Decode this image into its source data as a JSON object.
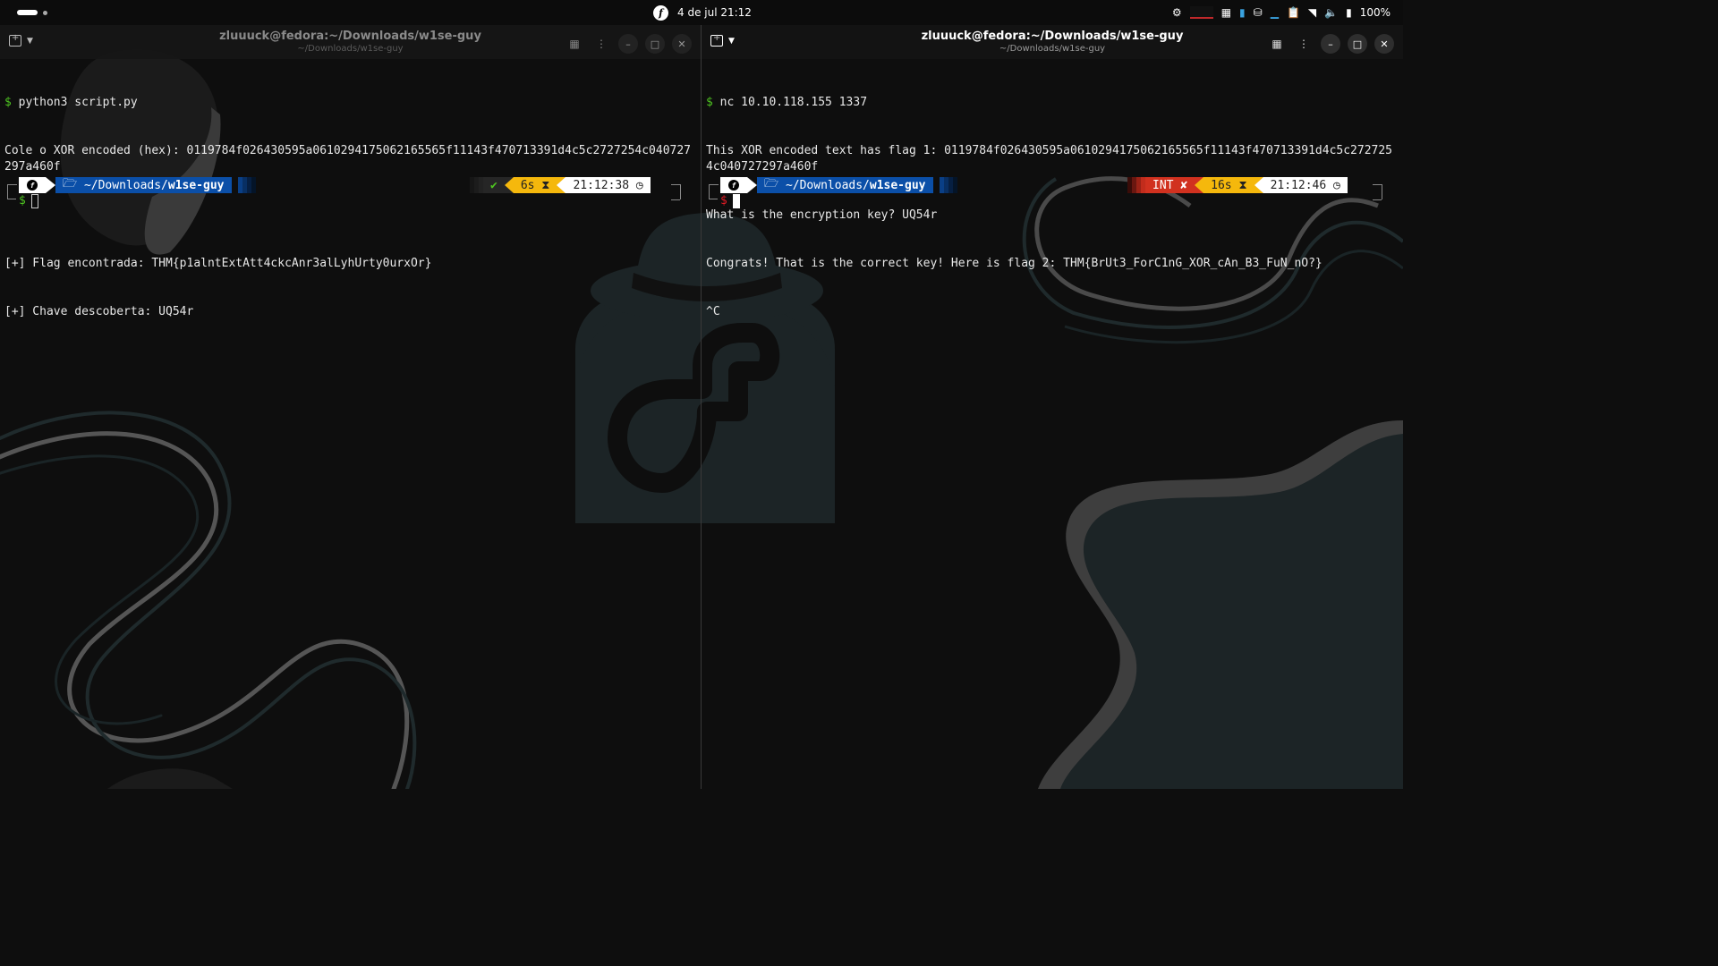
{
  "topbar": {
    "datetime": "4 de jul  21:12",
    "battery": "100%",
    "icons": [
      "activities-pill-icon",
      "fedora-logo-icon",
      "cpu-icon",
      "memory-icon",
      "network-monitor-icon",
      "drive-icon",
      "clipboard-icon",
      "wifi-icon",
      "volume-icon",
      "battery-icon"
    ]
  },
  "left_terminal": {
    "title": "zluuuck@fedora:~/Downloads/w1se-guy",
    "subtitle": "~/Downloads/w1se-guy",
    "lines": [
      {
        "sym": "$",
        "text": " python3 script.py"
      },
      {
        "sym": "",
        "text": "Cole o XOR encoded (hex): 0119784f026430595a0610294175062165565f11143f470713391d4c5c2727254c040727297a460f"
      },
      {
        "sym": "",
        "text": ""
      },
      {
        "sym": "",
        "text": "[+] Flag encontrada: THM{p1alntExtAtt4ckcAnr3alLyhUrty0urxOr}"
      },
      {
        "sym": "",
        "text": "[+] Chave descoberta: UQ54r"
      }
    ],
    "prompt": {
      "dir_prefix": " ~/Downloads/",
      "dir_bold": "w1se-guy",
      "status": "✔",
      "duration": "6s",
      "time": "21:12:38",
      "ps2": "$"
    }
  },
  "right_terminal": {
    "title": "zluuuck@fedora:~/Downloads/w1se-guy",
    "subtitle": "~/Downloads/w1se-guy",
    "lines": [
      {
        "sym": "$",
        "text": " nc 10.10.118.155 1337"
      },
      {
        "sym": "",
        "text": "This XOR encoded text has flag 1: 0119784f026430595a0610294175062165565f11143f470713391d4c5c2727254c040727297a460f"
      },
      {
        "sym": "",
        "text": "What is the encryption key? UQ54r"
      },
      {
        "sym": "",
        "text": "Congrats! That is the correct key! Here is flag 2: THM{BrUt3_ForC1nG_XOR_cAn_B3_FuN_nO?}"
      },
      {
        "sym": "",
        "text": "^C"
      }
    ],
    "prompt": {
      "dir_prefix": " ~/Downloads/",
      "dir_bold": "w1se-guy",
      "status": "INT ✘",
      "duration": "16s",
      "time": "21:12:46",
      "ps2": "$"
    }
  },
  "colors": {
    "prompt_green": "#4ec421",
    "prompt_red": "#e01b24",
    "dir_blue": "#0b4fa8",
    "duration_yellow": "#f5b80c",
    "int_red": "#d1311f"
  }
}
